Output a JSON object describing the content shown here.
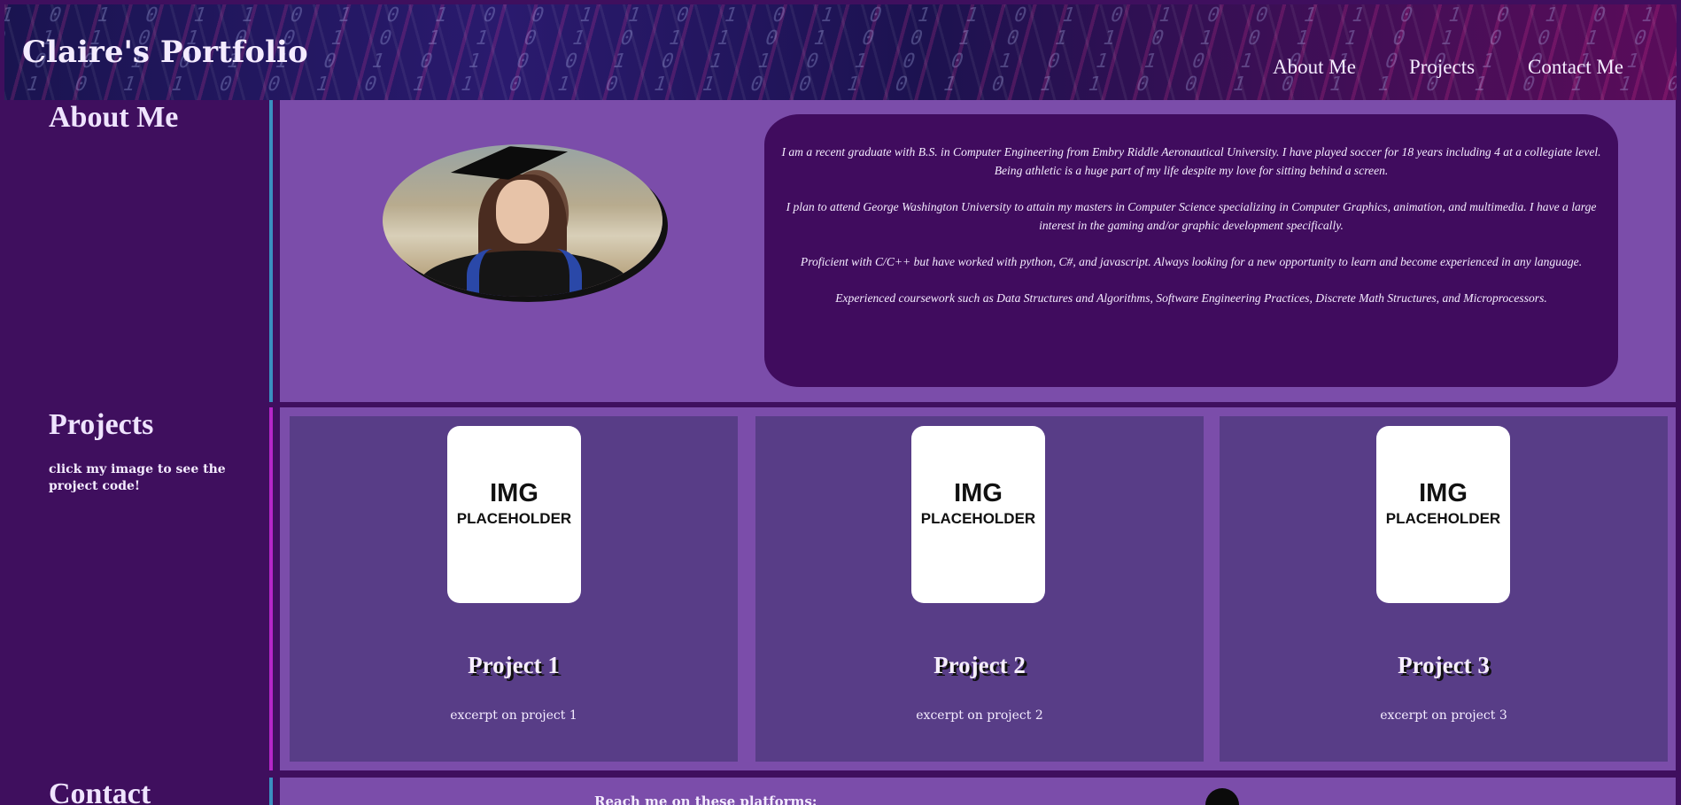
{
  "header": {
    "brand": "Claire's Portfolio",
    "nav": [
      "About Me",
      "Projects",
      "Contact Me"
    ]
  },
  "about": {
    "title": "About Me",
    "paragraphs": [
      "I am a recent graduate with B.S. in Computer Engineering from Embry Riddle Aeronautical University. I have played soccer for 18 years including 4 at a collegiate level. Being athletic is a huge part of my life despite my love for sitting behind a screen.",
      "I plan to attend George Washington University to attain my masters in Computer Science specializing in Computer Graphics, animation, and multimedia. I have a large interest in the gaming and/or graphic development specifically.",
      "Proficient with C/C++ but have worked with python, C#, and javascript. Always looking for a new opportunity to learn and become experienced in any language.",
      "Experienced coursework such as Data Structures and Algorithms, Software Engineering Practices, Discrete Math Structures, and Microprocessors."
    ]
  },
  "projects": {
    "title": "Projects",
    "note": "click my image to see the project code!",
    "placeholder_line1": "IMG",
    "placeholder_line2": "PLACEHOLDER",
    "items": [
      {
        "name": "Project 1",
        "excerpt": "excerpt on project 1"
      },
      {
        "name": "Project 2",
        "excerpt": "excerpt on project 2"
      },
      {
        "name": "Project 3",
        "excerpt": "excerpt on project 3"
      }
    ]
  },
  "contact": {
    "title": "Contact",
    "reach": "Reach me on these platforms:"
  },
  "colors": {
    "page_bg": "#3f0f5e",
    "panel": "#7b4daa",
    "card": "#583d87",
    "bio_bg": "#400c5e",
    "line_about": "#3a8fc0",
    "line_projects": "#b526c8"
  }
}
